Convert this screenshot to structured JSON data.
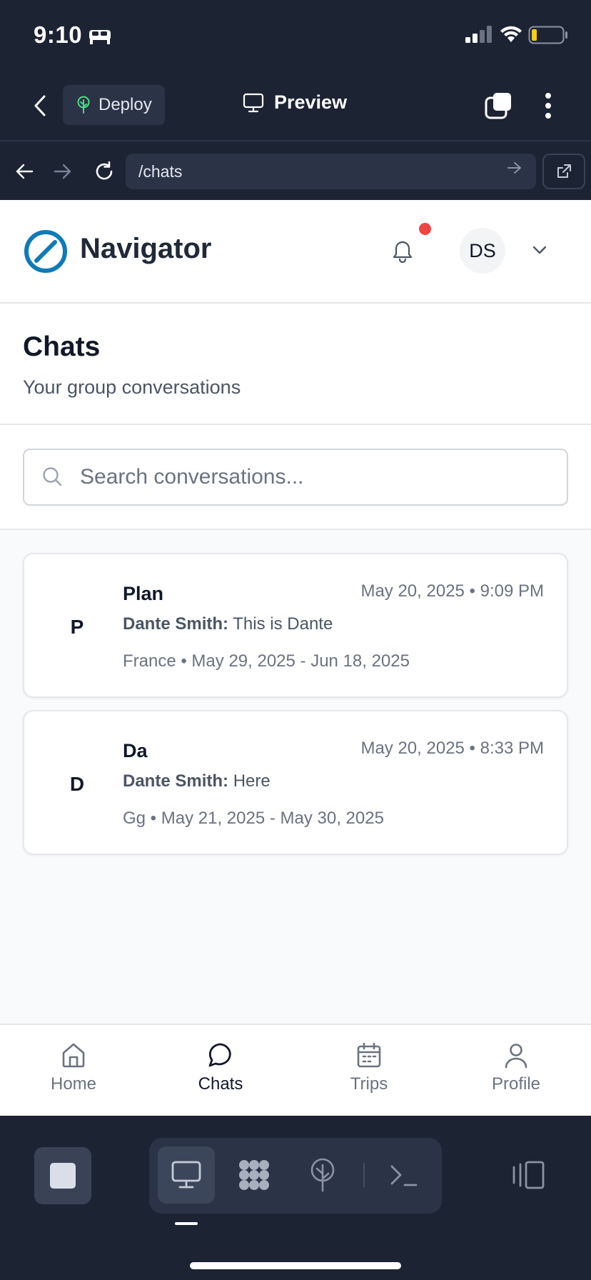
{
  "status_bar": {
    "time": "9:10"
  },
  "header": {
    "deploy_label": "Deploy",
    "preview_label": "Preview"
  },
  "url_bar": {
    "path": "/chats"
  },
  "site": {
    "brand": "Navigator",
    "avatar_initials": "DS",
    "brand_color": "#0e7ab8",
    "notification_color": "#ef4444"
  },
  "page": {
    "title": "Chats",
    "subtitle": "Your group conversations",
    "search_placeholder": "Search conversations..."
  },
  "chats": [
    {
      "initial": "P",
      "name": "Plan",
      "time": "May 20, 2025 • 9:09 PM",
      "sender": "Dante Smith:",
      "message": "This is Dante",
      "meta": "France • May 29, 2025 - Jun 18, 2025"
    },
    {
      "initial": "D",
      "name": "Da",
      "time": "May 20, 2025 • 8:33 PM",
      "sender": "Dante Smith:",
      "message": "Here",
      "meta": "Gg • May 21, 2025 - May 30, 2025"
    }
  ],
  "bottom_nav": {
    "items": [
      {
        "label": "Home",
        "icon": "home-icon"
      },
      {
        "label": "Chats",
        "icon": "chat-bubble-icon",
        "active": true
      },
      {
        "label": "Trips",
        "icon": "calendar-icon"
      },
      {
        "label": "Profile",
        "icon": "user-icon"
      }
    ]
  }
}
